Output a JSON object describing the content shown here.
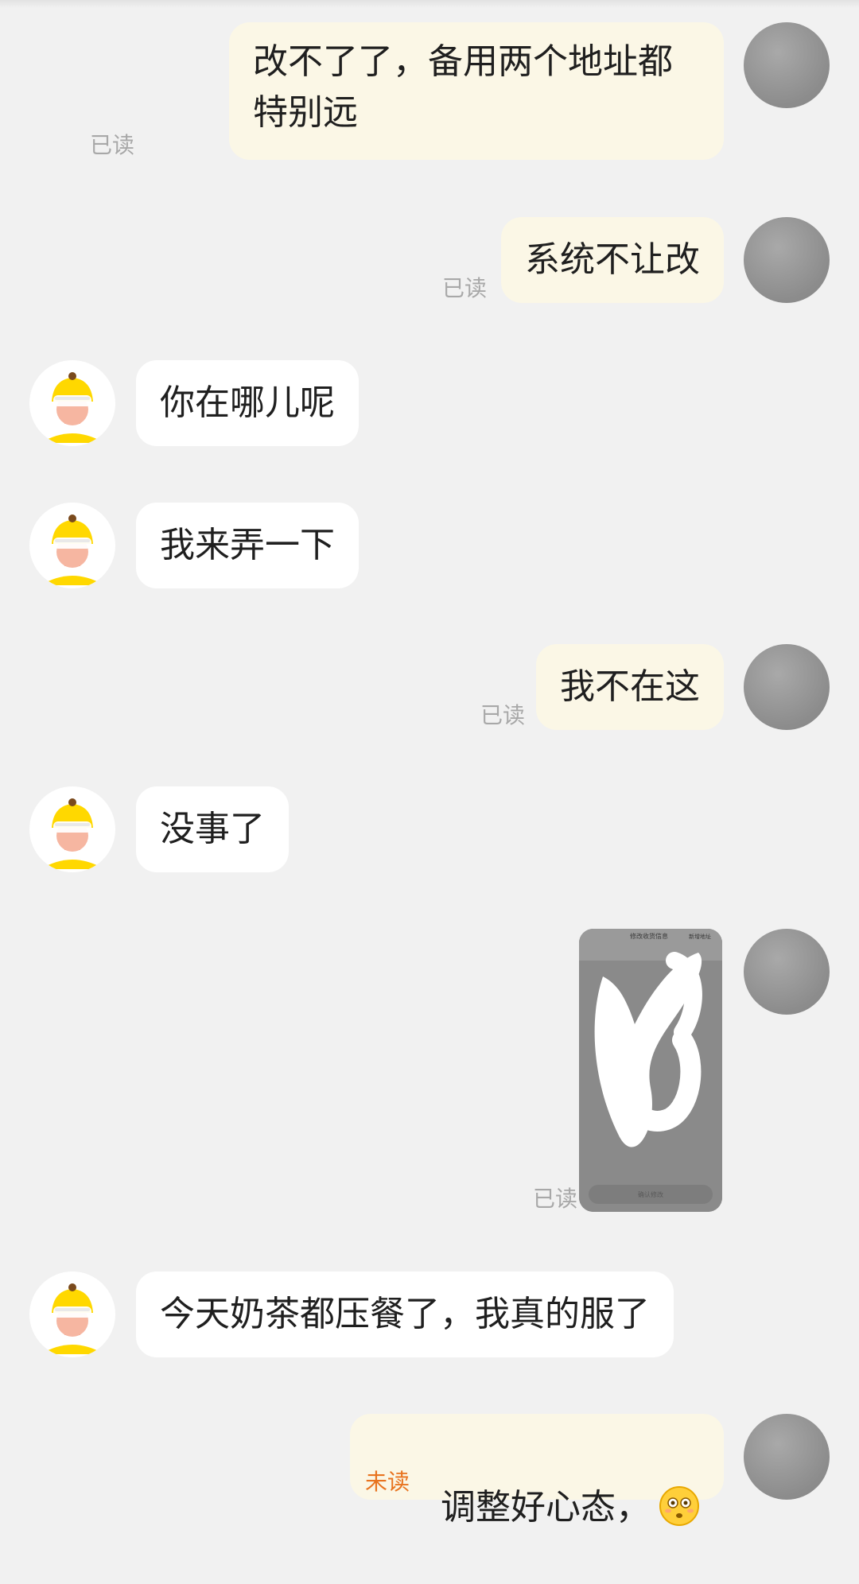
{
  "messages": [
    {
      "side": "self",
      "text": "改不了了，备用两个地址都特别远",
      "receipt": "已读"
    },
    {
      "side": "self",
      "text": "系统不让改",
      "receipt": "已读"
    },
    {
      "side": "other",
      "text": "你在哪儿呢"
    },
    {
      "side": "other",
      "text": "我来弄一下"
    },
    {
      "side": "self",
      "text": "我不在这",
      "receipt": "已读"
    },
    {
      "side": "other",
      "text": "没事了"
    },
    {
      "side": "self",
      "type": "image",
      "receipt": "已读",
      "image_title": "修改收货信息",
      "image_corner": "新增地址",
      "image_button": "确认修改"
    },
    {
      "side": "other",
      "text": "今天奶茶都压餐了，我真的服了"
    },
    {
      "side": "self",
      "text": "调整好心态，",
      "emoji": "flushed-face",
      "receipt": "未读"
    }
  ],
  "colors": {
    "background": "#f1f1f1",
    "self_bubble": "#fbf7e6",
    "other_bubble": "#ffffff",
    "read_receipt": "#a8a8a8",
    "unread_receipt": "#e8731f",
    "rider_helmet": "#ffd800"
  }
}
